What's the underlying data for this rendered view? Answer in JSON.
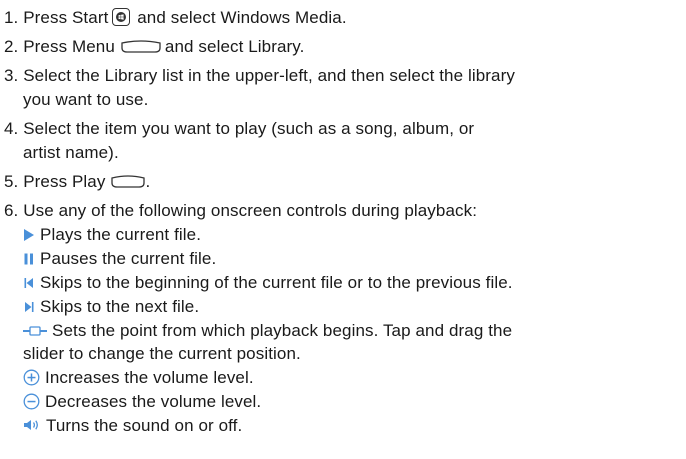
{
  "steps": [
    {
      "num": "1.",
      "before": "Press Start",
      "after": "and select Windows Media.",
      "icon": "windows-start-key-icon"
    },
    {
      "num": "2.",
      "before": "Press Menu",
      "after": "and select Library.",
      "icon": "left-soft-key-icon"
    },
    {
      "num": "3.",
      "line1": "Select the Library list in the upper-left, and then select the library",
      "line2": "you want to use."
    },
    {
      "num": "4.",
      "line1": "Select the item you want to play (such as a song, album, or",
      "line2": "artist name)."
    },
    {
      "num": "5.",
      "before": "Press Play",
      "after": ".",
      "icon": "right-soft-key-icon"
    },
    {
      "num": "6.",
      "text": "Use any of the following onscreen controls during playback:"
    }
  ],
  "controls": [
    {
      "icon": "play-icon",
      "text": "Plays the current file."
    },
    {
      "icon": "pause-icon",
      "text": "Pauses the current file."
    },
    {
      "icon": "previous-icon",
      "text": "Skips to the beginning of the current file or to the previous file."
    },
    {
      "icon": "next-icon",
      "text": "Skips to the next file."
    },
    {
      "icon": "seek-slider-icon",
      "line1": "Sets the point from which playback begins. Tap and drag the",
      "line2": "slider to change the current position."
    },
    {
      "icon": "volume-up-icon",
      "text": "Increases the volume level."
    },
    {
      "icon": "volume-down-icon",
      "text": "Decreases the volume level."
    },
    {
      "icon": "speaker-mute-icon",
      "text": "Turns the sound on or off."
    }
  ],
  "colors": {
    "text": "#1a1a1a",
    "control_icon": "#4a90d9",
    "outline": "#333333"
  }
}
